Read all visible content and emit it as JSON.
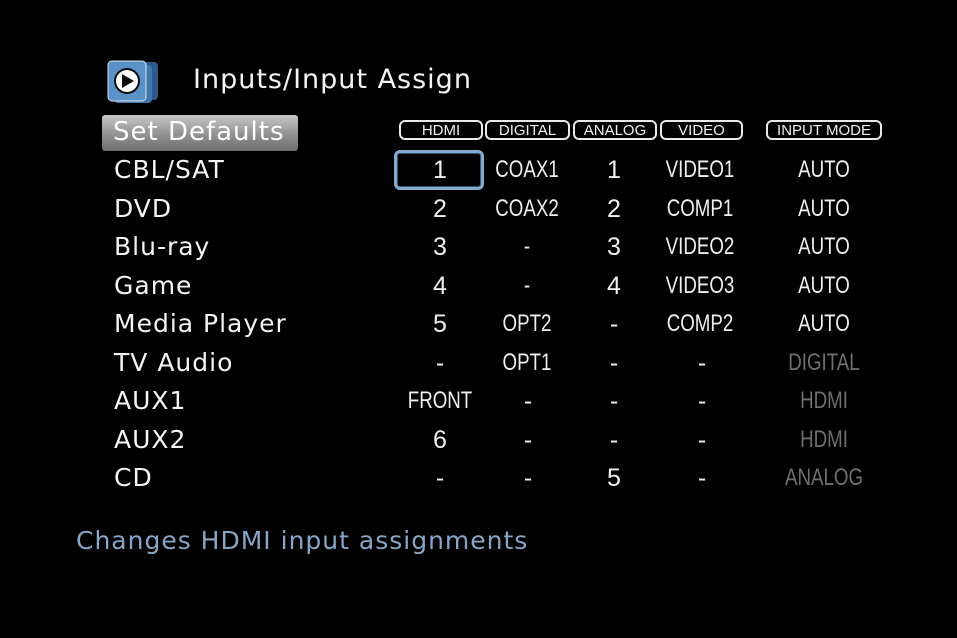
{
  "page": {
    "title": "Inputs/Input Assign",
    "help_text": "Changes HDMI input assignments"
  },
  "set_defaults_label": "Set Defaults",
  "columns": [
    "HDMI",
    "DIGITAL",
    "ANALOG",
    "VIDEO",
    "INPUT MODE"
  ],
  "rows": [
    {
      "label": "CBL/SAT",
      "cells": [
        "1",
        "COAX1",
        "1",
        "VIDEO1",
        "AUTO"
      ]
    },
    {
      "label": "DVD",
      "cells": [
        "2",
        "COAX2",
        "2",
        "COMP1",
        "AUTO"
      ]
    },
    {
      "label": "Blu-ray",
      "cells": [
        "3",
        "-",
        "3",
        "VIDEO2",
        "AUTO"
      ]
    },
    {
      "label": "Game",
      "cells": [
        "4",
        "-",
        "4",
        "VIDEO3",
        "AUTO"
      ]
    },
    {
      "label": "Media Player",
      "cells": [
        "5",
        "OPT2",
        "-",
        "COMP2",
        "AUTO"
      ]
    },
    {
      "label": "TV Audio",
      "cells": [
        "-",
        "OPT1",
        "-",
        "-",
        "DIGITAL"
      ]
    },
    {
      "label": "AUX1",
      "cells": [
        "FRONT",
        "-",
        "-",
        "-",
        "HDMI"
      ]
    },
    {
      "label": "AUX2",
      "cells": [
        "6",
        "-",
        "-",
        "-",
        "HDMI"
      ]
    },
    {
      "label": "CD",
      "cells": [
        "-",
        "-",
        "5",
        "-",
        "ANALOG"
      ]
    }
  ],
  "selected_cell": {
    "row": "CBL/SAT",
    "column": "HDMI"
  },
  "colors": {
    "background": "#000000",
    "text": "#f4f4f4",
    "help_text": "#87a5c6",
    "selection_border": "#86aacd",
    "dimmed_text": "#6f6f6f"
  },
  "icons": {
    "header": "input-assign-arrow-icon"
  }
}
